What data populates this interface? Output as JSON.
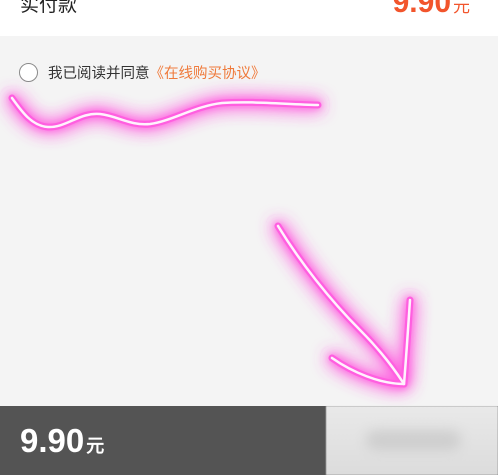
{
  "payment": {
    "label": "实付款",
    "amount": "9.90",
    "unit": "元"
  },
  "agreement": {
    "prefix": "我已阅读并同意",
    "link": "《在线购买协议》"
  },
  "bottom_bar": {
    "amount": "9.90",
    "unit": "元"
  },
  "colors": {
    "price_accent": "#f2552c",
    "link": "#ef7a3b",
    "bottom_bar": "#545454",
    "annotation": "#ff4fd8"
  }
}
